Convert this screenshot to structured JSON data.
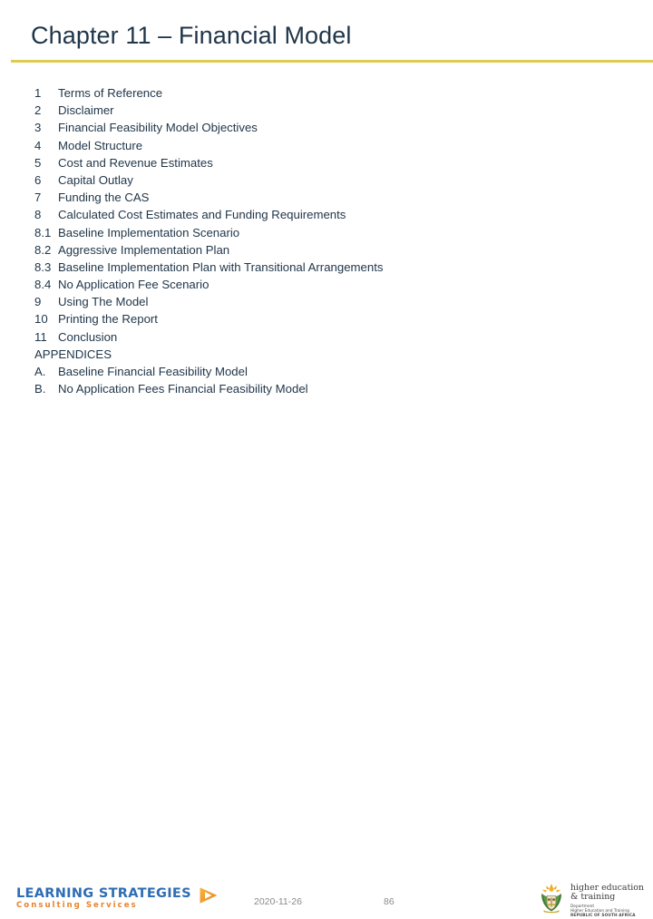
{
  "slide": {
    "title": "Chapter 11 – Financial Model",
    "accent_rule_color": "#E0CB52",
    "title_color": "#1F3548",
    "body_color": "#1F3548"
  },
  "contents": [
    {
      "num": "1",
      "text": "Terms of Reference"
    },
    {
      "num": "2",
      "text": "Disclaimer"
    },
    {
      "num": "3",
      "text": "Financial Feasibility Model Objectives"
    },
    {
      "num": "4",
      "text": "Model Structure"
    },
    {
      "num": "5",
      "text": "Cost and Revenue Estimates"
    },
    {
      "num": "6",
      "text": "Capital Outlay"
    },
    {
      "num": "7",
      "text": "Funding the CAS"
    },
    {
      "num": "8",
      "text": "Calculated Cost Estimates and Funding Requirements"
    },
    {
      "num": "8.1",
      "text": "Baseline Implementation Scenario"
    },
    {
      "num": "8.2",
      "text": "Aggressive Implementation Plan"
    },
    {
      "num": "8.3",
      "text": "Baseline Implementation Plan with Transitional Arrangements"
    },
    {
      "num": "8.4",
      "text": "No Application Fee Scenario"
    },
    {
      "num": "9",
      "text": "Using The Model"
    },
    {
      "num": "10",
      "text": "Printing the Report"
    },
    {
      "num": "11",
      "text": "Conclusion"
    },
    {
      "num": "",
      "text": "APPENDICES"
    },
    {
      "num": "A.",
      "text": "Baseline Financial Feasibility Model"
    },
    {
      "num": "B.",
      "text": "No Application Fees Financial Feasibility Model"
    }
  ],
  "footer": {
    "date": "2020-11-26",
    "page_number": "86",
    "text_color": "#8A8A8A"
  },
  "left_logo": {
    "name": "Learning Strategies",
    "line1": "LEARNING STRATEGIES",
    "line2": "Consulting Services",
    "line1_color": "#2E6DB4",
    "line2_color": "#E8832A",
    "mark_color": "#F2A32B"
  },
  "right_logo": {
    "name": "Department of Higher Education and Training, Republic of South Africa",
    "line1": "higher education",
    "line2": "& training",
    "small_line1": "Department",
    "small_line2": "Higher Education and Training",
    "small_line3": "REPUBLIC OF SOUTH AFRICA"
  }
}
